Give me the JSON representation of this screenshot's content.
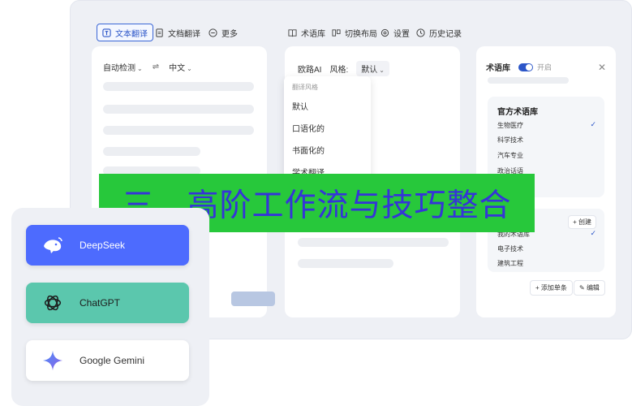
{
  "toolbar": {
    "tabs": [
      {
        "label": "文本翻译",
        "icon": "text-icon",
        "active": true
      },
      {
        "label": "文档翻译",
        "icon": "document-icon",
        "active": false
      },
      {
        "label": "更多",
        "icon": "more-icon",
        "active": false
      }
    ],
    "actions": [
      {
        "label": "术语库",
        "icon": "book-icon"
      },
      {
        "label": "切换布局",
        "icon": "layout-icon"
      },
      {
        "label": "设置",
        "icon": "gear-icon"
      },
      {
        "label": "历史记录",
        "icon": "clock-icon"
      }
    ]
  },
  "source_panel": {
    "source_lang": "自动检测",
    "swap_icon": "swap-icon",
    "target_lang": "中文"
  },
  "result_panel": {
    "engine": "欧路AI",
    "style_label": "风格:",
    "style_value": "默认"
  },
  "style_dropdown": {
    "title": "翻译风格",
    "options": [
      "默认",
      "口语化的",
      "书面化的",
      "学术翻译"
    ]
  },
  "glossary_panel": {
    "title": "术语库",
    "toggle_label": "开启",
    "toggle_on": true,
    "official": {
      "title": "官方术语库",
      "items": [
        {
          "label": "生物医疗",
          "checked": true
        },
        {
          "label": "科学技术",
          "checked": false
        },
        {
          "label": "汽车专业",
          "checked": false
        },
        {
          "label": "政治话语",
          "checked": false
        }
      ]
    },
    "mine": {
      "create_label": "+ 创建",
      "items": [
        {
          "label": "我的术语库",
          "checked": true
        },
        {
          "label": "电子技术",
          "checked": false
        },
        {
          "label": "建筑工程",
          "checked": false
        }
      ]
    },
    "add_label": "+ 添加单条",
    "edit_label": "编辑"
  },
  "banner": {
    "text": "三、高阶工作流与技巧整合"
  },
  "ai_cards": [
    {
      "label": "DeepSeek",
      "icon": "deepseek-whale-icon"
    },
    {
      "label": "ChatGPT",
      "icon": "chatgpt-icon"
    },
    {
      "label": "Google Gemini",
      "icon": "gemini-star-icon"
    }
  ],
  "colors": {
    "accent": "#2c56c8",
    "banner_bg": "#27c83b",
    "banner_text": "#3534d8",
    "deepseek": "#4d6bfe",
    "chatgpt": "#5bc7ad"
  }
}
